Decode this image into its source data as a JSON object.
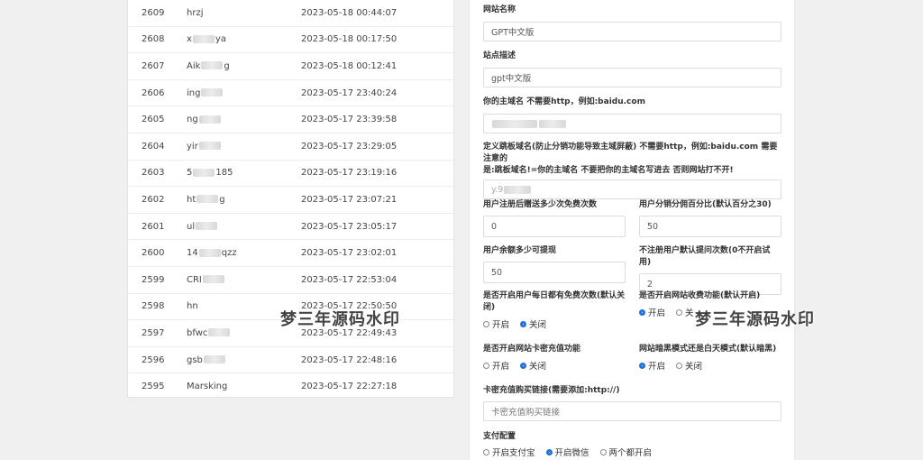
{
  "table": {
    "rows": [
      {
        "id": "2609",
        "user": "hrzj",
        "time": "2023-05-18 00:44:07"
      },
      {
        "id": "2608",
        "user": "x  ya",
        "time": "2023-05-18 00:17:50"
      },
      {
        "id": "2607",
        "user": "Aik  g",
        "time": "2023-05-18 00:12:41"
      },
      {
        "id": "2606",
        "user": "ing",
        "time": "2023-05-17 23:40:24"
      },
      {
        "id": "2605",
        "user": "ng",
        "time": "2023-05-17 23:39:58"
      },
      {
        "id": "2604",
        "user": "yir",
        "time": "2023-05-17 23:29:05"
      },
      {
        "id": "2603",
        "user": "5  185",
        "time": "2023-05-17 23:19:16"
      },
      {
        "id": "2602",
        "user": "ht  g",
        "time": "2023-05-17 23:07:21"
      },
      {
        "id": "2601",
        "user": "ul",
        "time": "2023-05-17 23:05:17"
      },
      {
        "id": "2600",
        "user": "14  qzz",
        "time": "2023-05-17 23:02:01"
      },
      {
        "id": "2599",
        "user": "CRI",
        "time": "2023-05-17 22:53:04"
      },
      {
        "id": "2598",
        "user": "hn",
        "time": "2023-05-17 22:50:50"
      },
      {
        "id": "2597",
        "user": "bfwc",
        "time": "2023-05-17 22:49:43"
      },
      {
        "id": "2596",
        "user": "gsb",
        "time": "2023-05-17 22:48:16"
      },
      {
        "id": "2595",
        "user": "Marsking",
        "time": "2023-05-17 22:27:18"
      }
    ]
  },
  "form": {
    "site_name": {
      "label": "网站名称",
      "value": "GPT中文版"
    },
    "site_desc": {
      "label": "站点描述",
      "value": "gpt中文版"
    },
    "main_domain": {
      "label": "你的主域名 不需要http，例如:baidu.com",
      "value": ""
    },
    "jump_domain": {
      "label_line1": "定义跳板域名(防止分销功能导致主域屏蔽) 不需要http，例如:baidu.com 需要注意的",
      "label_line2": "是:跳板域名!=你的主域名 不要把你的主域名写进去 否则网站打不开!",
      "value": "y.9"
    },
    "reg_free": {
      "label": "用户注册后赠送多少次免费次数",
      "value": "0"
    },
    "commission": {
      "label": "用户分销分佣百分比(默认百分之30)",
      "value": "50"
    },
    "withdraw": {
      "label": "用户余额多少可提现",
      "value": "50"
    },
    "unreg_times": {
      "label": "不注册用户默认提问次数(0不开启试用)",
      "value": "2"
    },
    "daily_free": {
      "label": "是否开启用户每日都有免费次数(默认关闭)",
      "opt1": "开启",
      "opt2": "关闭"
    },
    "charge_fn": {
      "label": "是否开启网站收费功能(默认开启)",
      "opt1": "开启",
      "opt2": "关"
    },
    "card_fn": {
      "label": "是否开启网站卡密充值功能",
      "opt1": "开启",
      "opt2": "关闭"
    },
    "dark_mode": {
      "label": "网站暗黑模式还是白天模式(默认暗黑)",
      "opt1": "开启",
      "opt2": "关闭"
    },
    "card_link": {
      "label": "卡密充值购买链接(需要添加:http://)",
      "placeholder": "卡密充值购买链接"
    },
    "pay": {
      "label": "支付配置",
      "opt1": "开启支付宝",
      "opt2": "开启微信",
      "opt3": "两个都开启"
    }
  },
  "watermark": {
    "text": "梦三年源码水印"
  },
  "colors": {
    "accent": "#1e6fd9",
    "page_bg": "#f0f0f1"
  }
}
